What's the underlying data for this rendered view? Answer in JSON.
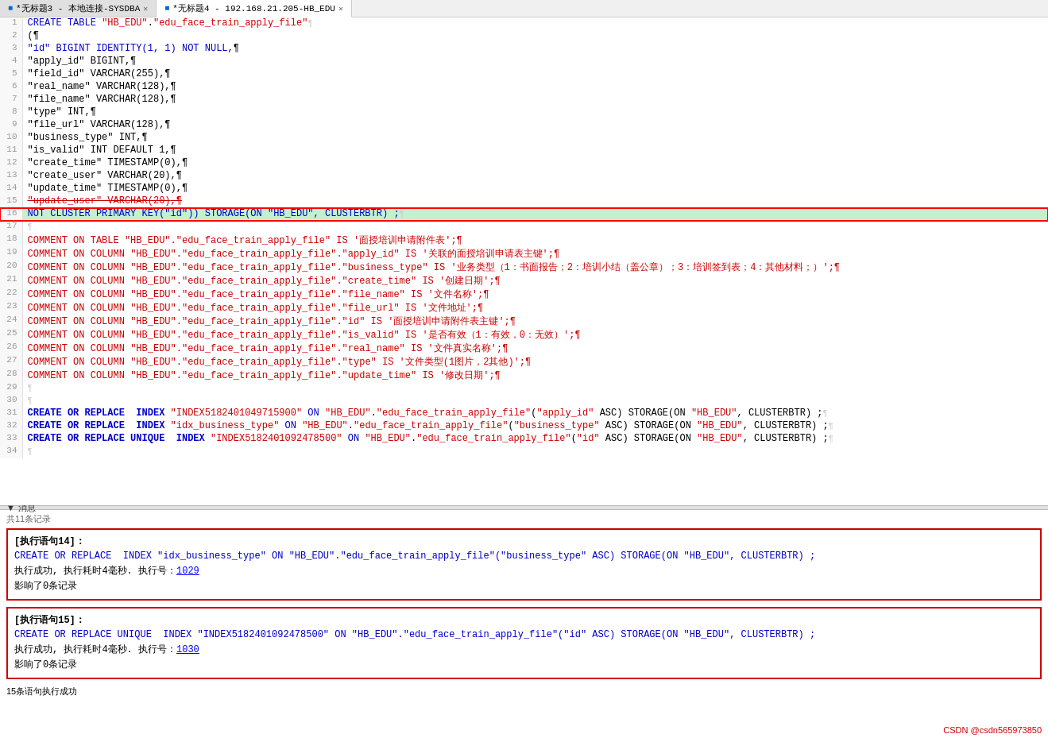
{
  "tabs": [
    {
      "id": "tab1",
      "label": "*无标题3 - 本地连接-SYSDBA",
      "active": false,
      "modified": true
    },
    {
      "id": "tab2",
      "label": "*无标题4 - 192.168.21.205-HB_EDU",
      "active": true,
      "modified": true
    }
  ],
  "editor": {
    "lines": [
      {
        "num": 1,
        "tokens": [
          {
            "t": "CREATE TABLE ",
            "c": "kw"
          },
          {
            "t": "\"HB_EDU\"",
            "c": "str"
          },
          {
            "t": ".",
            "c": "plain"
          },
          {
            "t": "\"edu_face_train_apply_file\"",
            "c": "str"
          },
          {
            "t": "¶",
            "c": "eol"
          }
        ]
      },
      {
        "num": 2,
        "tokens": [
          {
            "t": "(¶",
            "c": "plain"
          }
        ]
      },
      {
        "num": 3,
        "tokens": [
          {
            "t": "\"id\" BIGINT IDENTITY(1, 1) NOT NULL",
            "c": "kw"
          },
          {
            "t": ",¶",
            "c": "plain"
          }
        ]
      },
      {
        "num": 4,
        "tokens": [
          {
            "t": "\"apply_id\" BIGINT",
            "c": "plain"
          },
          {
            "t": ",¶",
            "c": "plain"
          }
        ]
      },
      {
        "num": 5,
        "tokens": [
          {
            "t": "\"field_id\" VARCHAR(255)",
            "c": "plain"
          },
          {
            "t": ",¶",
            "c": "plain"
          }
        ]
      },
      {
        "num": 6,
        "tokens": [
          {
            "t": "\"real_name\" VARCHAR(128)",
            "c": "plain"
          },
          {
            "t": ",¶",
            "c": "plain"
          }
        ]
      },
      {
        "num": 7,
        "tokens": [
          {
            "t": "\"file_name\" VARCHAR(128)",
            "c": "plain"
          },
          {
            "t": ",¶",
            "c": "plain"
          }
        ]
      },
      {
        "num": 8,
        "tokens": [
          {
            "t": "\"type\" INT",
            "c": "plain"
          },
          {
            "t": ",¶",
            "c": "plain"
          }
        ]
      },
      {
        "num": 9,
        "tokens": [
          {
            "t": "\"file_url\" VARCHAR(128)",
            "c": "plain"
          },
          {
            "t": ",¶",
            "c": "plain"
          }
        ]
      },
      {
        "num": 10,
        "tokens": [
          {
            "t": "\"business_type\" INT",
            "c": "plain"
          },
          {
            "t": ",¶",
            "c": "plain"
          }
        ]
      },
      {
        "num": 11,
        "tokens": [
          {
            "t": "\"is_valid\" INT DEFAULT 1",
            "c": "plain"
          },
          {
            "t": ",¶",
            "c": "plain"
          }
        ]
      },
      {
        "num": 12,
        "tokens": [
          {
            "t": "\"create_time\" TIMESTAMP(0)",
            "c": "plain"
          },
          {
            "t": ",¶",
            "c": "plain"
          }
        ]
      },
      {
        "num": 13,
        "tokens": [
          {
            "t": "\"create_user\" VARCHAR(20)",
            "c": "plain"
          },
          {
            "t": ",¶",
            "c": "plain"
          }
        ]
      },
      {
        "num": 14,
        "tokens": [
          {
            "t": "\"update_time\" TIMESTAMP(0)",
            "c": "plain"
          },
          {
            "t": ",¶",
            "c": "plain"
          }
        ]
      },
      {
        "num": 15,
        "tokens": [
          {
            "t": "\"update_user\" VARCHAR(20)",
            "c": "plain"
          },
          {
            "t": ",¶",
            "c": "plain"
          }
        ],
        "strikethrough": true
      },
      {
        "num": 16,
        "tokens": [
          {
            "t": "NOT CLUSTER PRIMARY KEY(\"id\")) STORAGE(ON \"HB_EDU\", CLUSTERBTR) ;",
            "c": "kw"
          },
          {
            "t": "¶",
            "c": "eol"
          }
        ],
        "highlight": true
      },
      {
        "num": 17,
        "tokens": [
          {
            "t": "¶",
            "c": "eol"
          }
        ]
      },
      {
        "num": 18,
        "tokens": [
          {
            "t": "COMMENT ON TABLE ",
            "c": "comment-line"
          },
          {
            "t": "\"HB_EDU\"",
            "c": "comment-line"
          },
          {
            "t": ".",
            "c": "comment-line"
          },
          {
            "t": "\"edu_face_train_apply_file\"",
            "c": "comment-line"
          },
          {
            "t": " IS '面授培训申请附件表'",
            "c": "comment-line"
          },
          {
            "t": ";¶",
            "c": "comment-line"
          }
        ]
      },
      {
        "num": 19,
        "tokens": [
          {
            "t": "COMMENT ON COLUMN ",
            "c": "comment-line"
          },
          {
            "t": "\"HB_EDU\"",
            "c": "comment-line"
          },
          {
            "t": ".",
            "c": "comment-line"
          },
          {
            "t": "\"edu_face_train_apply_file\"",
            "c": "comment-line"
          },
          {
            "t": ".",
            "c": "comment-line"
          },
          {
            "t": "\"apply_id\"",
            "c": "comment-line"
          },
          {
            "t": " IS '关联的面授培训申请表主键'",
            "c": "comment-line"
          },
          {
            "t": ";¶",
            "c": "comment-line"
          }
        ]
      },
      {
        "num": 20,
        "tokens": [
          {
            "t": "COMMENT ON COLUMN ",
            "c": "comment-line"
          },
          {
            "t": "\"HB_EDU\"",
            "c": "comment-line"
          },
          {
            "t": ".",
            "c": "comment-line"
          },
          {
            "t": "\"edu_face_train_apply_file\"",
            "c": "comment-line"
          },
          {
            "t": ".",
            "c": "comment-line"
          },
          {
            "t": "\"business_type\"",
            "c": "comment-line"
          },
          {
            "t": " IS '业务类型（1：书面报告；2：培训小结（盖公章）；3：培训签到表；4：其他材料；）'",
            "c": "comment-line"
          },
          {
            "t": ";¶",
            "c": "comment-line"
          }
        ]
      },
      {
        "num": 21,
        "tokens": [
          {
            "t": "COMMENT ON COLUMN ",
            "c": "comment-line"
          },
          {
            "t": "\"HB_EDU\"",
            "c": "comment-line"
          },
          {
            "t": ".",
            "c": "comment-line"
          },
          {
            "t": "\"edu_face_train_apply_file\"",
            "c": "comment-line"
          },
          {
            "t": ".",
            "c": "comment-line"
          },
          {
            "t": "\"create_time\"",
            "c": "comment-line"
          },
          {
            "t": " IS '创建日期'",
            "c": "comment-line"
          },
          {
            "t": ";¶",
            "c": "comment-line"
          }
        ]
      },
      {
        "num": 22,
        "tokens": [
          {
            "t": "COMMENT ON COLUMN ",
            "c": "comment-line"
          },
          {
            "t": "\"HB_EDU\"",
            "c": "comment-line"
          },
          {
            "t": ".",
            "c": "comment-line"
          },
          {
            "t": "\"edu_face_train_apply_file\"",
            "c": "comment-line"
          },
          {
            "t": ".",
            "c": "comment-line"
          },
          {
            "t": "\"file_name\"",
            "c": "comment-line"
          },
          {
            "t": " IS '文件名称'",
            "c": "comment-line"
          },
          {
            "t": ";¶",
            "c": "comment-line"
          }
        ]
      },
      {
        "num": 23,
        "tokens": [
          {
            "t": "COMMENT ON COLUMN ",
            "c": "comment-line"
          },
          {
            "t": "\"HB_EDU\"",
            "c": "comment-line"
          },
          {
            "t": ".",
            "c": "comment-line"
          },
          {
            "t": "\"edu_face_train_apply_file\"",
            "c": "comment-line"
          },
          {
            "t": ".",
            "c": "comment-line"
          },
          {
            "t": "\"file_url\"",
            "c": "comment-line"
          },
          {
            "t": " IS '文件地址'",
            "c": "comment-line"
          },
          {
            "t": ";¶",
            "c": "comment-line"
          }
        ]
      },
      {
        "num": 24,
        "tokens": [
          {
            "t": "COMMENT ON COLUMN ",
            "c": "comment-line"
          },
          {
            "t": "\"HB_EDU\"",
            "c": "comment-line"
          },
          {
            "t": ".",
            "c": "comment-line"
          },
          {
            "t": "\"edu_face_train_apply_file\"",
            "c": "comment-line"
          },
          {
            "t": ".",
            "c": "comment-line"
          },
          {
            "t": "\"id\"",
            "c": "comment-line"
          },
          {
            "t": " IS '面授培训申请附件表主键'",
            "c": "comment-line"
          },
          {
            "t": ";¶",
            "c": "comment-line"
          }
        ]
      },
      {
        "num": 25,
        "tokens": [
          {
            "t": "COMMENT ON COLUMN ",
            "c": "comment-line"
          },
          {
            "t": "\"HB_EDU\"",
            "c": "comment-line"
          },
          {
            "t": ".",
            "c": "comment-line"
          },
          {
            "t": "\"edu_face_train_apply_file\"",
            "c": "comment-line"
          },
          {
            "t": ".",
            "c": "comment-line"
          },
          {
            "t": "\"is_valid\"",
            "c": "comment-line"
          },
          {
            "t": " IS '是否有效（1：有效，0：无效）'",
            "c": "comment-line"
          },
          {
            "t": ";¶",
            "c": "comment-line"
          }
        ]
      },
      {
        "num": 26,
        "tokens": [
          {
            "t": "COMMENT ON COLUMN ",
            "c": "comment-line"
          },
          {
            "t": "\"HB_EDU\"",
            "c": "comment-line"
          },
          {
            "t": ".",
            "c": "comment-line"
          },
          {
            "t": "\"edu_face_train_apply_file\"",
            "c": "comment-line"
          },
          {
            "t": ".",
            "c": "comment-line"
          },
          {
            "t": "\"real_name\"",
            "c": "comment-line"
          },
          {
            "t": " IS '文件真实名称'",
            "c": "comment-line"
          },
          {
            "t": ";¶",
            "c": "comment-line"
          }
        ]
      },
      {
        "num": 27,
        "tokens": [
          {
            "t": "COMMENT ON COLUMN ",
            "c": "comment-line"
          },
          {
            "t": "\"HB_EDU\"",
            "c": "comment-line"
          },
          {
            "t": ".",
            "c": "comment-line"
          },
          {
            "t": "\"edu_face_train_apply_file\"",
            "c": "comment-line"
          },
          {
            "t": ".",
            "c": "comment-line"
          },
          {
            "t": "\"type\"",
            "c": "comment-line"
          },
          {
            "t": " IS '文件类型(1图片，2其他)'",
            "c": "comment-line"
          },
          {
            "t": ";¶",
            "c": "comment-line"
          }
        ]
      },
      {
        "num": 28,
        "tokens": [
          {
            "t": "COMMENT ON COLUMN ",
            "c": "comment-line"
          },
          {
            "t": "\"HB_EDU\"",
            "c": "comment-line"
          },
          {
            "t": ".",
            "c": "comment-line"
          },
          {
            "t": "\"edu_face_train_apply_file\"",
            "c": "comment-line"
          },
          {
            "t": ".",
            "c": "comment-line"
          },
          {
            "t": "\"update_time\"",
            "c": "comment-line"
          },
          {
            "t": " IS '修改日期'",
            "c": "comment-line"
          },
          {
            "t": ";¶",
            "c": "comment-line"
          }
        ]
      },
      {
        "num": 29,
        "tokens": [
          {
            "t": "¶",
            "c": "eol"
          }
        ]
      },
      {
        "num": 30,
        "tokens": [
          {
            "t": "¶",
            "c": "eol"
          }
        ]
      },
      {
        "num": 31,
        "tokens": [
          {
            "t": "CREATE OR REPLACE  INDEX ",
            "c": "create-kw"
          },
          {
            "t": "\"INDEX5182401049715900\"",
            "c": "str"
          },
          {
            "t": " ON ",
            "c": "kw"
          },
          {
            "t": "\"HB_EDU\"",
            "c": "str"
          },
          {
            "t": ".",
            "c": "plain"
          },
          {
            "t": "\"edu_face_train_apply_file\"",
            "c": "str"
          },
          {
            "t": "(",
            "c": "plain"
          },
          {
            "t": "\"apply_id\"",
            "c": "str"
          },
          {
            "t": " ASC) STORAGE(ON ",
            "c": "plain"
          },
          {
            "t": "\"HB_EDU\"",
            "c": "str"
          },
          {
            "t": ", CLUSTERBTR) ;",
            "c": "plain"
          },
          {
            "t": "¶",
            "c": "eol"
          }
        ]
      },
      {
        "num": 32,
        "tokens": [
          {
            "t": "CREATE OR REPLACE  INDEX ",
            "c": "create-kw"
          },
          {
            "t": "\"idx_business_type\"",
            "c": "str"
          },
          {
            "t": " ON ",
            "c": "kw"
          },
          {
            "t": "\"HB_EDU\"",
            "c": "str"
          },
          {
            "t": ".",
            "c": "plain"
          },
          {
            "t": "\"edu_face_train_apply_file\"",
            "c": "str"
          },
          {
            "t": "(",
            "c": "plain"
          },
          {
            "t": "\"business_type\"",
            "c": "str"
          },
          {
            "t": " ASC) STORAGE(ON ",
            "c": "plain"
          },
          {
            "t": "\"HB_EDU\"",
            "c": "str"
          },
          {
            "t": ", CLUSTERBTR) ;",
            "c": "plain"
          },
          {
            "t": "¶",
            "c": "eol"
          }
        ]
      },
      {
        "num": 33,
        "tokens": [
          {
            "t": "CREATE OR REPLACE UNIQUE  INDEX ",
            "c": "create-kw"
          },
          {
            "t": "\"INDEX5182401092478500\"",
            "c": "str"
          },
          {
            "t": " ON ",
            "c": "kw"
          },
          {
            "t": "\"HB_EDU\"",
            "c": "str"
          },
          {
            "t": ".",
            "c": "plain"
          },
          {
            "t": "\"edu_face_train_apply_file\"",
            "c": "str"
          },
          {
            "t": "(",
            "c": "plain"
          },
          {
            "t": "\"id\"",
            "c": "str"
          },
          {
            "t": " ASC) STORAGE(ON ",
            "c": "plain"
          },
          {
            "t": "\"HB_EDU\"",
            "c": "str"
          },
          {
            "t": ", CLUSTERBTR) ;",
            "c": "plain"
          },
          {
            "t": "¶",
            "c": "eol"
          }
        ]
      },
      {
        "num": 34,
        "tokens": [
          {
            "t": "¶",
            "c": "eol"
          }
        ]
      }
    ]
  },
  "messages_panel": {
    "label": "消息",
    "header": "共11条记录",
    "blocks": [
      {
        "stmt_label": "[执行语句14]：",
        "sql": "CREATE OR REPLACE  INDEX \"idx_business_type\" ON \"HB_EDU\".\"edu_face_train_apply_file\"(\"business_type\" ASC) STORAGE(ON \"HB_EDU\", CLUSTERBTR) ;",
        "result_text": "执行成功, 执行耗时4毫秒. 执行号：",
        "exec_num": "1029",
        "affected": "影响了0条记录"
      },
      {
        "stmt_label": "[执行语句15]：",
        "sql": "CREATE OR REPLACE UNIQUE  INDEX \"INDEX5182401092478500\" ON \"HB_EDU\".\"edu_face_train_apply_file\"(\"id\" ASC) STORAGE(ON \"HB_EDU\", CLUSTERBTR) ;",
        "result_text": "执行成功, 执行耗时4毫秒. 执行号：",
        "exec_num": "1030",
        "affected": "影响了0条记录"
      }
    ],
    "footer": "15条语句执行成功"
  },
  "watermark": "CSDN @csdn565973850",
  "colors": {
    "keyword": "#0000cc",
    "string": "#cc0000",
    "comment": "#cc0000",
    "highlight_bg": "#c6efce",
    "highlight_border": "#ff0000"
  }
}
